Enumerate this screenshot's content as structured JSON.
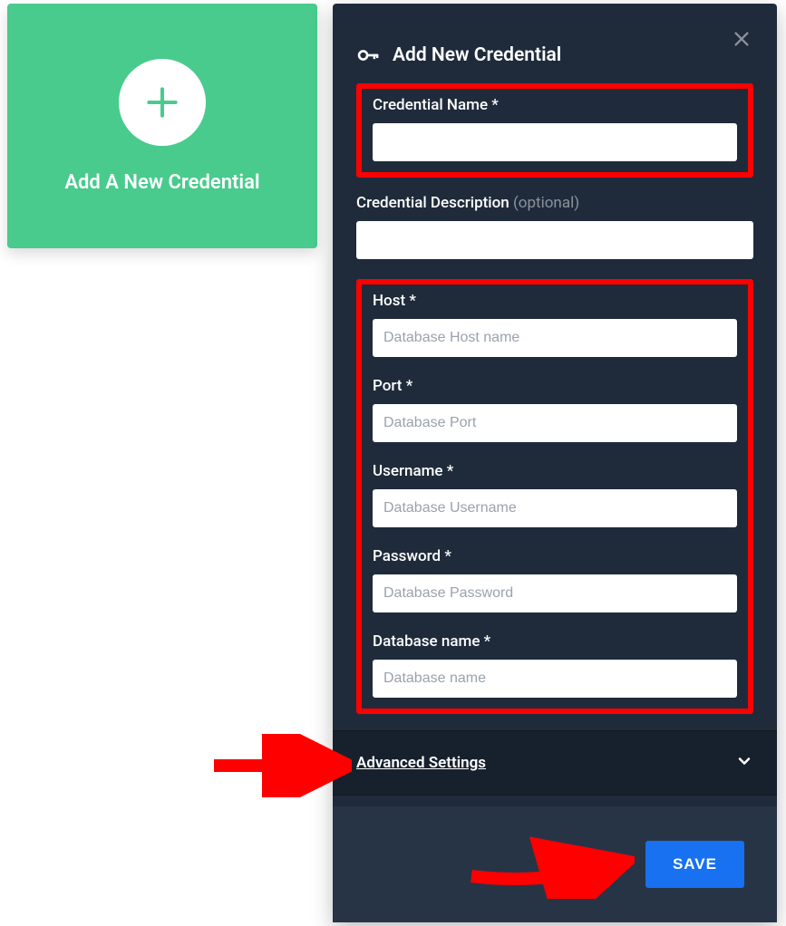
{
  "left_card": {
    "label": "Add A New Credential"
  },
  "panel": {
    "title": "Add New Credential",
    "credential_name": {
      "label": "Credential Name *",
      "value": "",
      "placeholder": ""
    },
    "credential_description": {
      "label": "Credential Description ",
      "optional": "(optional)",
      "value": "",
      "placeholder": ""
    },
    "host": {
      "label": "Host *",
      "value": "",
      "placeholder": "Database Host name"
    },
    "port": {
      "label": "Port *",
      "value": "",
      "placeholder": "Database Port"
    },
    "username": {
      "label": "Username *",
      "value": "",
      "placeholder": "Database Username"
    },
    "password": {
      "label": "Password *",
      "value": "",
      "placeholder": "Database Password"
    },
    "database": {
      "label": "Database name *",
      "value": "",
      "placeholder": "Database name"
    },
    "advanced_label": "Advanced Settings",
    "save_label": "SAVE"
  },
  "colors": {
    "accent_green": "#48cb8d",
    "panel_bg": "#1f2b3b",
    "panel_footer": "#273446",
    "primary_blue": "#1771f1",
    "annotation_red": "#ff0000"
  }
}
